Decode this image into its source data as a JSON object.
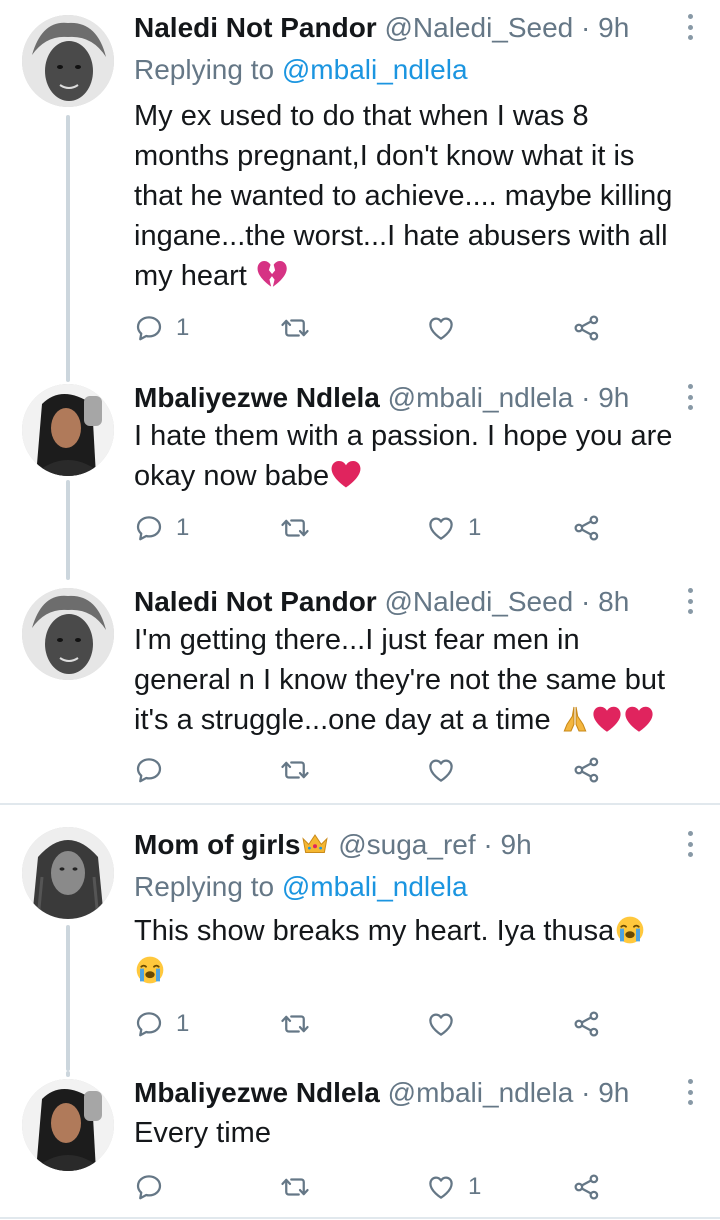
{
  "tweets": [
    {
      "name": "Naledi Not Pandor",
      "handle": "@Naledi_Seed",
      "time": "9h",
      "dot": "·",
      "replying_prefix": "Replying to",
      "replying_to": "@mbali_ndlela",
      "text_lines": [
        "My ex used to do that when I was 8",
        "months pregnant,I don't know what it is",
        "that he wanted to achieve.... maybe killing",
        "ingane...the worst...I hate abusers with all",
        "my heart"
      ],
      "emoji_after": "broken-heart",
      "reply_count": "1",
      "retweet_count": "",
      "like_count": ""
    },
    {
      "name": "Mbaliyezwe Ndlela",
      "handle": "@mbali_ndlela",
      "time": "9h",
      "dot": "·",
      "text_lines": [
        "I hate them with a passion. I hope you are",
        "okay now babe"
      ],
      "emoji_after": "red-heart",
      "reply_count": "1",
      "retweet_count": "",
      "like_count": "1"
    },
    {
      "name": "Naledi Not Pandor",
      "handle": "@Naledi_Seed",
      "time": "8h",
      "dot": "·",
      "text_lines": [
        "I'm getting there...I just fear men in",
        "general n I know they're not the same but",
        "it's a struggle...one day at a time"
      ],
      "emoji_after": "pray-heart-heart",
      "reply_count": "",
      "retweet_count": "",
      "like_count": ""
    },
    {
      "name": "Mom of girls",
      "name_emoji": "crown",
      "handle": "@suga_ref",
      "time": "9h",
      "dot": "·",
      "replying_prefix": "Replying to",
      "replying_to": "@mbali_ndlela",
      "text_lines": [
        "This show breaks my heart. Iya thusa"
      ],
      "emoji_after": "loudly-crying",
      "reply_count": "1",
      "retweet_count": "",
      "like_count": ""
    },
    {
      "name": "Mbaliyezwe Ndlela",
      "handle": "@mbali_ndlela",
      "time": "9h",
      "dot": "·",
      "text_lines": [
        "Every time"
      ],
      "reply_count": "",
      "retweet_count": "",
      "like_count": "1"
    }
  ],
  "colors": {
    "name": "#14171a",
    "meta": "#657786",
    "link": "#1b95e0",
    "thread_line": "#ccd6dd",
    "divider": "#e1e8ed",
    "heart_red": "#e0245e"
  },
  "icons": [
    "reply-icon",
    "retweet-icon",
    "like-icon",
    "share-icon",
    "more-options-icon"
  ]
}
